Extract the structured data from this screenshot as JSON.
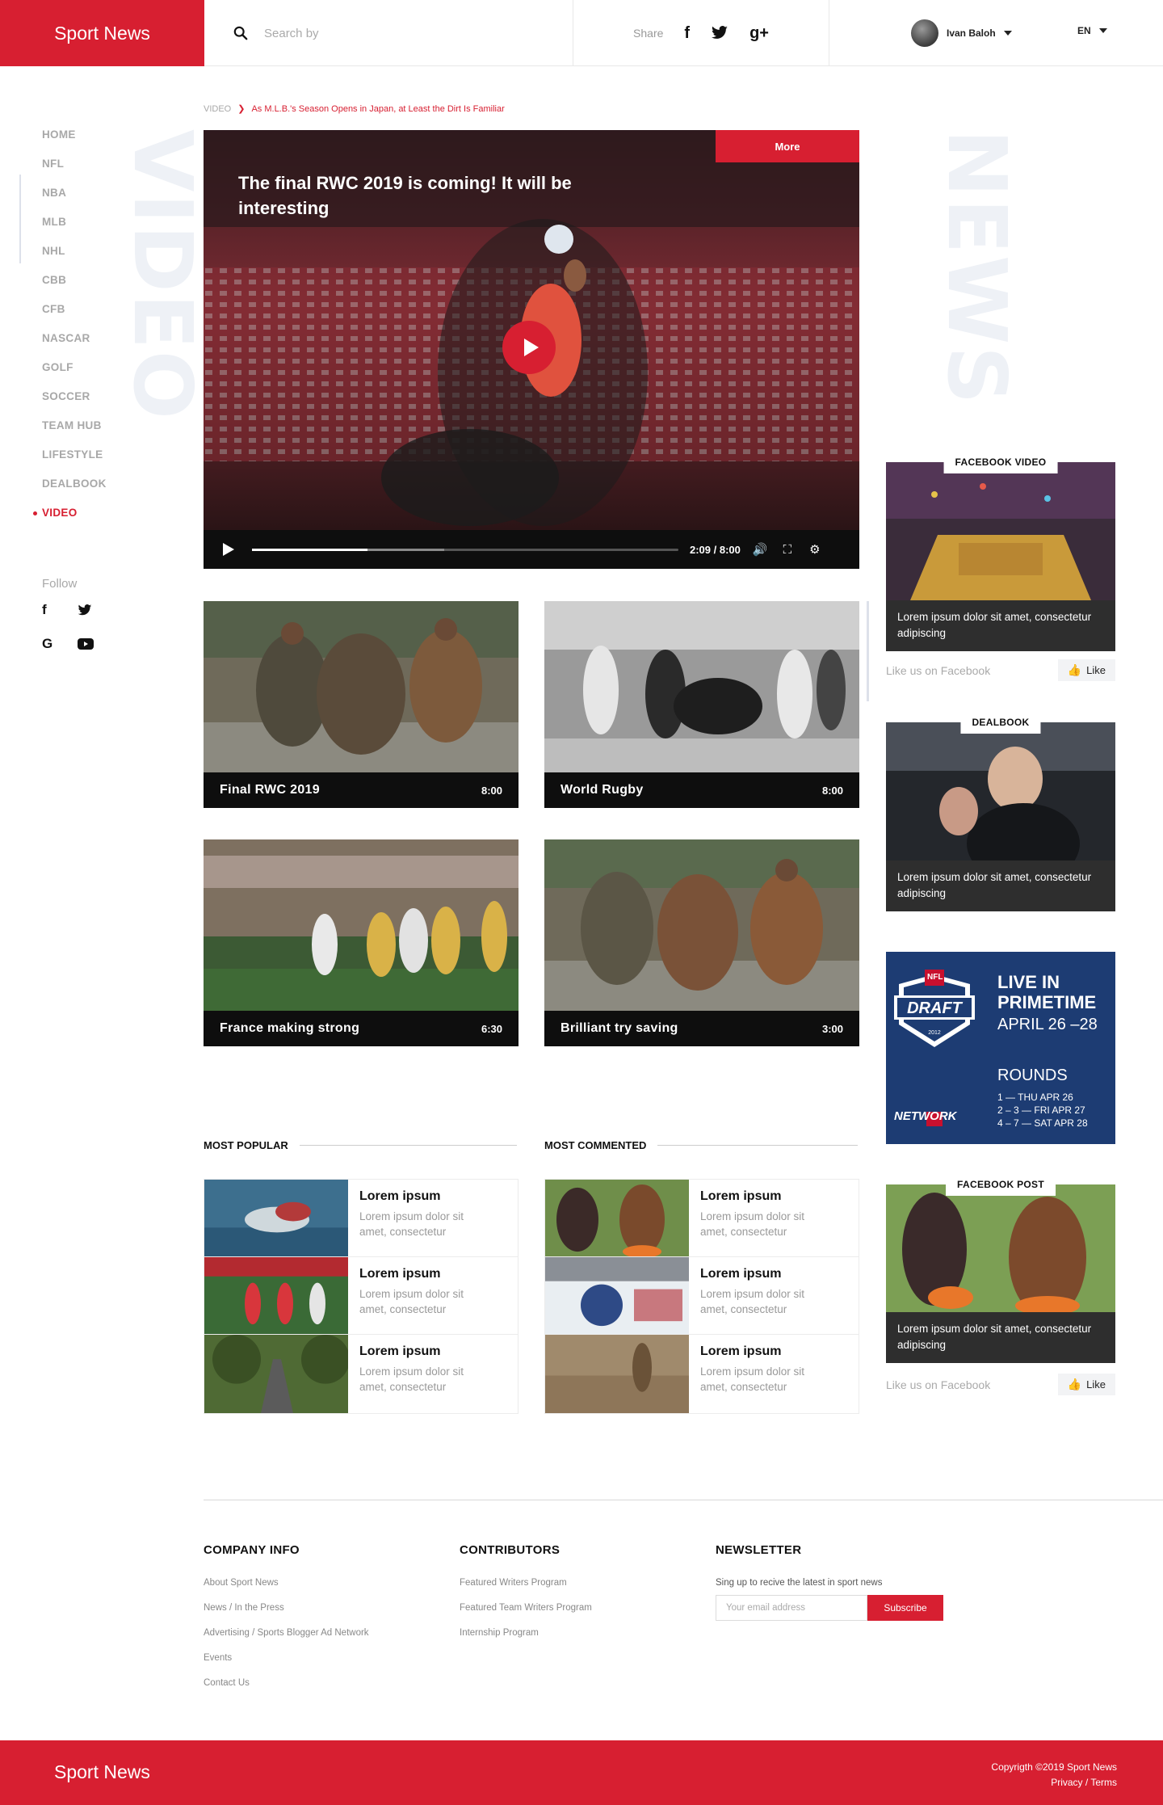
{
  "brand": {
    "name": "Sport News",
    "accent": "#d71f31"
  },
  "header": {
    "search_placeholder": "Search by",
    "share_label": "Share",
    "share_icons": [
      "facebook-icon",
      "twitter-icon",
      "google-plus-icon"
    ],
    "user_name": "Ivan Baloh",
    "language": "EN"
  },
  "sidebar": {
    "items": [
      {
        "label": "HOME"
      },
      {
        "label": "NFL"
      },
      {
        "label": "NBA"
      },
      {
        "label": "MLB"
      },
      {
        "label": "NHL"
      },
      {
        "label": "CBB"
      },
      {
        "label": "CFB"
      },
      {
        "label": "NASCAR"
      },
      {
        "label": "GOLF"
      },
      {
        "label": "SOCCER"
      },
      {
        "label": "TEAM HUB"
      },
      {
        "label": "LIFESTYLE"
      },
      {
        "label": "DEALBOOK"
      },
      {
        "label": "VIDEO",
        "active": true
      }
    ],
    "follow_label": "Follow",
    "follow_icons": [
      "facebook-icon",
      "twitter-icon",
      "google-icon",
      "youtube-icon"
    ]
  },
  "watermarks": {
    "left": "VIDEO",
    "right": "NEWS"
  },
  "breadcrumb": {
    "root": "VIDEO",
    "current": "As M.L.B.'s Season Opens in Japan, at Least the Dirt Is Familiar"
  },
  "main_video": {
    "title": "The final RWC 2019  is coming! It will be interesting",
    "more_label": "More",
    "time": "2:09 / 8:00",
    "progress": 0.27,
    "buffered": 0.45
  },
  "video_cards": [
    {
      "title": "Final RWC 2019",
      "duration": "8:00"
    },
    {
      "title": "World Rugby",
      "duration": "8:00"
    },
    {
      "title": "France making strong",
      "duration": "6:30"
    },
    {
      "title": "Brilliant try saving",
      "duration": "3:00"
    }
  ],
  "most_popular": {
    "heading": "MOST POPULAR",
    "items": [
      {
        "title": "Lorem ipsum",
        "desc": "Lorem ipsum dolor sit amet, consectetur"
      },
      {
        "title": "Lorem ipsum",
        "desc": "Lorem ipsum dolor sit amet, consectetur"
      },
      {
        "title": "Lorem ipsum",
        "desc": "Lorem ipsum dolor sit amet, consectetur"
      }
    ]
  },
  "most_commented": {
    "heading": "MOST COMMENTED",
    "items": [
      {
        "title": "Lorem ipsum",
        "desc": "Lorem ipsum dolor sit amet, consectetur"
      },
      {
        "title": "Lorem ipsum",
        "desc": "Lorem ipsum dolor sit amet, consectetur"
      },
      {
        "title": "Lorem ipsum",
        "desc": "Lorem ipsum dolor sit amet, consectetur"
      }
    ]
  },
  "right_rail": {
    "facebook_video": {
      "label": "FACEBOOK VIDEO",
      "text": "Lorem ipsum dolor sit amet, consectetur adipiscing"
    },
    "dealbook": {
      "label": "DEALBOOK",
      "text": "Lorem ipsum dolor sit amet, consectetur adipiscing"
    },
    "facebook_post": {
      "label": "FACEBOOK POST",
      "text": "Lorem ipsum dolor sit amet, consectetur adipiscing"
    },
    "like_us": "Like us on Facebook",
    "like_label": "Like",
    "ad": {
      "badge_top": "NFL",
      "badge_main": "DRAFT",
      "badge_year": "2012",
      "line1": "LIVE IN",
      "line2": "PRIMETIME",
      "dates": "APRIL 26 –28",
      "rounds_label": "ROUNDS",
      "rounds": [
        "1 — THU APR 26",
        "2 – 3 — FRI APR 27",
        "4 – 7 — SAT APR 28"
      ],
      "network": "NETWORK"
    }
  },
  "footer": {
    "company": {
      "title": "COMPANY INFO",
      "links": [
        "About Sport News",
        "News / In the Press",
        "Advertising / Sports Blogger Ad Network",
        "Events",
        "Contact Us"
      ]
    },
    "contributors": {
      "title": "CONTRIBUTORS",
      "links": [
        "Featured Writers Program",
        "Featured Team Writers Program",
        "Internship Program"
      ]
    },
    "newsletter": {
      "title": "NEWSLETTER",
      "text": "Sing up to recive the latest in sport news",
      "placeholder": "Your email address",
      "button": "Subscribe"
    },
    "copyright": "Copyrigth ©2019 Sport News",
    "legal": "Privacy / Terms"
  }
}
